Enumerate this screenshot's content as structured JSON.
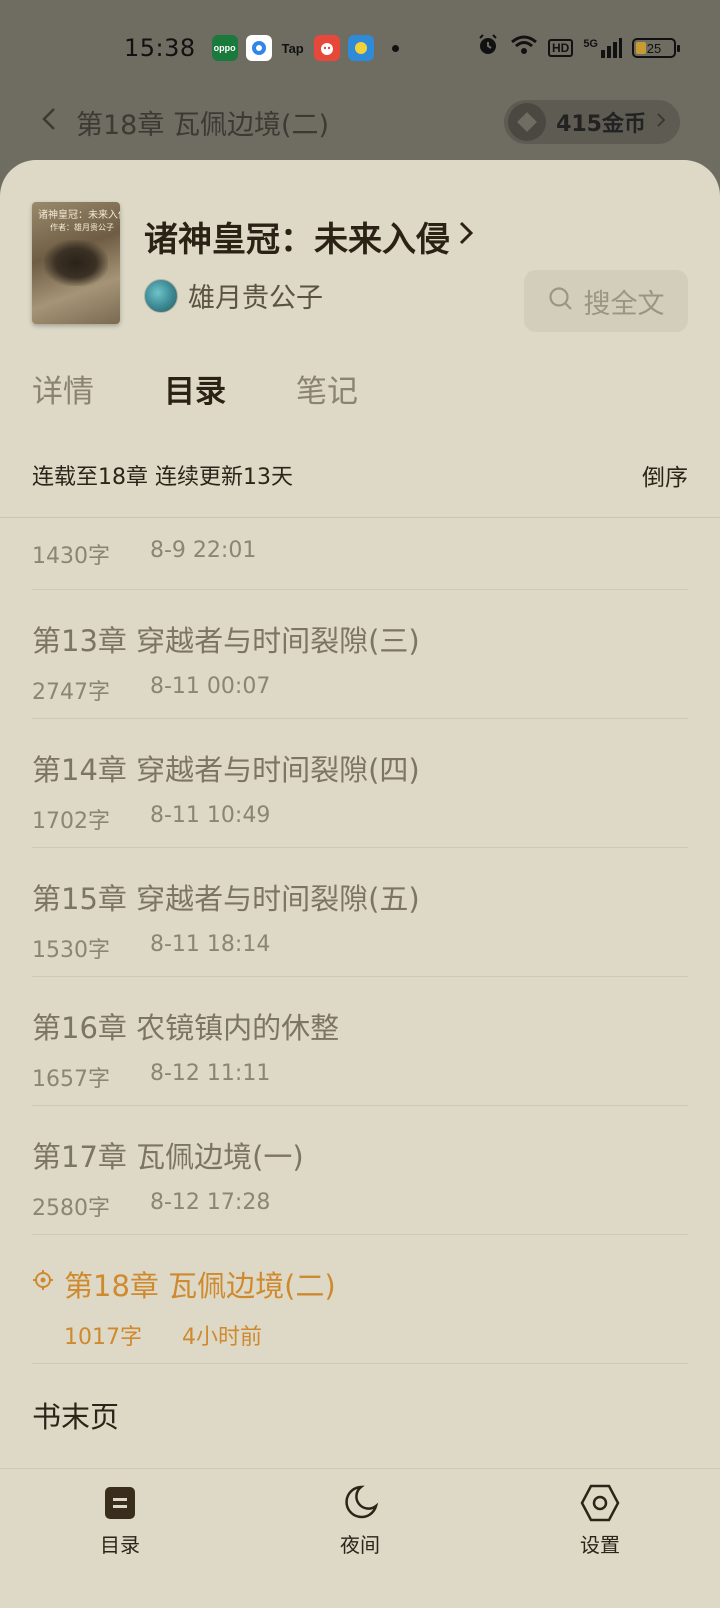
{
  "status_bar": {
    "time": "15:38",
    "apps": [
      {
        "name": "oppo",
        "label": "oppo",
        "color": "#1a7a3c"
      },
      {
        "name": "browser",
        "label": "",
        "color": "#ffffff"
      },
      {
        "name": "taptap",
        "label": "Tap",
        "color": "#6f6d62"
      },
      {
        "name": "app-red",
        "label": "",
        "color": "#e6493a"
      },
      {
        "name": "app-blue",
        "label": "",
        "color": "#2f8ad8"
      }
    ],
    "network": "5G",
    "hd": "HD",
    "battery": "25"
  },
  "reader": {
    "chapter_title": "第18章 瓦佩边境(二)",
    "coins": "415金币"
  },
  "book": {
    "title": "诸神皇冠：未来入侵",
    "author": "雄月贵公子",
    "cover_title": "诸神皇冠：未来入侵",
    "cover_author": "作者：雄月贵公子",
    "search_label": "搜全文"
  },
  "tabs": [
    {
      "label": "详情",
      "active": false
    },
    {
      "label": "目录",
      "active": true
    },
    {
      "label": "笔记",
      "active": false
    }
  ],
  "summary": {
    "text": "连载至18章 连续更新13天",
    "sort_label": "倒序"
  },
  "chapters": [
    {
      "title": "",
      "words": "1430字",
      "time": "8-9 22:01",
      "partial": true
    },
    {
      "title": "第13章 穿越者与时间裂隙(三)",
      "words": "2747字",
      "time": "8-11 00:07"
    },
    {
      "title": "第14章 穿越者与时间裂隙(四)",
      "words": "1702字",
      "time": "8-11 10:49"
    },
    {
      "title": "第15章 穿越者与时间裂隙(五)",
      "words": "1530字",
      "time": "8-11 18:14"
    },
    {
      "title": "第16章 农镜镇内的休整",
      "words": "1657字",
      "time": "8-12 11:11"
    },
    {
      "title": "第17章 瓦佩边境(一)",
      "words": "2580字",
      "time": "8-12 17:28"
    },
    {
      "title": "第18章 瓦佩边境(二)",
      "words": "1017字",
      "time": "4小时前",
      "current": true
    }
  ],
  "book_end_label": "书末页",
  "bottom_nav": [
    {
      "label": "目录",
      "icon": "toc-icon"
    },
    {
      "label": "夜间",
      "icon": "moon-icon"
    },
    {
      "label": "设置",
      "icon": "settings-icon"
    }
  ],
  "colors": {
    "sheet_bg": "#ddd9c6",
    "accent_current": "#cf8a2f",
    "dim_overlay": "#6f6d62"
  }
}
